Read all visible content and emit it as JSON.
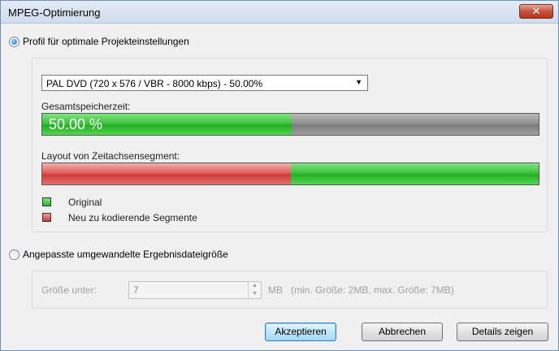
{
  "window": {
    "title": "MPEG-Optimierung",
    "close_label": "✕"
  },
  "option_profile": {
    "label": "Profil für optimale Projekteinstellungen",
    "checked": true
  },
  "profile_select": {
    "value": "PAL DVD (720 x 576 / VBR - 8000 kbps) - 50.00%"
  },
  "storage": {
    "label": "Gesamtspeicherzeit:",
    "percent_text": "50.00 %",
    "fill_fraction": 0.5
  },
  "layout": {
    "label": "Layout von Zeitachsensegment:",
    "reencode_fraction": 0.5
  },
  "legend": [
    {
      "label": "Original",
      "color": "#33c433"
    },
    {
      "label": "Neu zu kodierende Segmente",
      "color": "#d84848"
    }
  ],
  "option_custom": {
    "label": "Angepasste umgewandelte Ergebnisdateigröße",
    "checked": false
  },
  "custom_size": {
    "label": "Größe unter:",
    "value": "7",
    "unit_hint": "MB   (min. Größe: 2MB, max. Größe: 7MB)"
  },
  "buttons": {
    "accept": "Akzeptieren",
    "cancel": "Abbrechen",
    "details": "Details zeigen"
  }
}
